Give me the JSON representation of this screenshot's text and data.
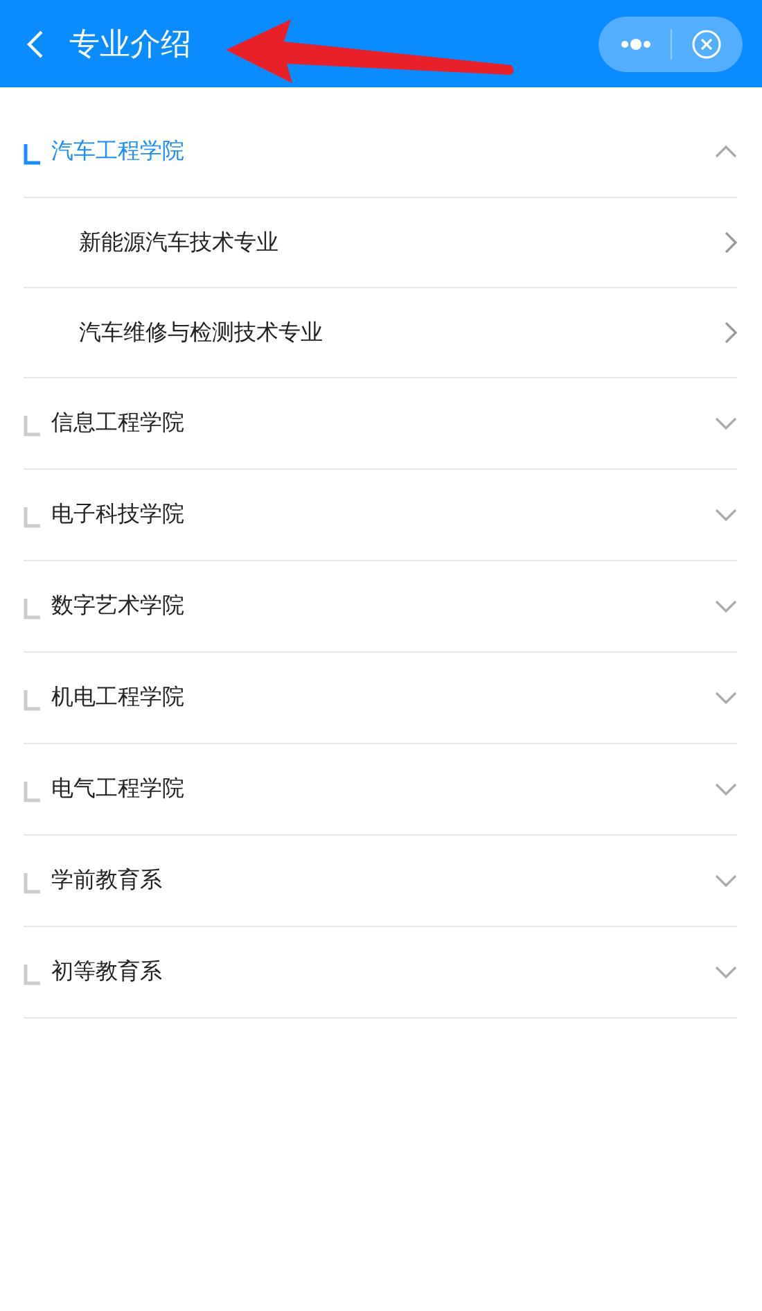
{
  "header": {
    "title": "专业介绍"
  },
  "departments": [
    {
      "name": "汽车工程学院",
      "expanded": true,
      "children": [
        {
          "name": "新能源汽车技术专业"
        },
        {
          "name": "汽车维修与检测技术专业"
        }
      ]
    },
    {
      "name": "信息工程学院",
      "expanded": false
    },
    {
      "name": "电子科技学院",
      "expanded": false
    },
    {
      "name": "数字艺术学院",
      "expanded": false
    },
    {
      "name": "机电工程学院",
      "expanded": false
    },
    {
      "name": "电气工程学院",
      "expanded": false
    },
    {
      "name": "学前教育系",
      "expanded": false
    },
    {
      "name": "初等教育系",
      "expanded": false
    }
  ]
}
